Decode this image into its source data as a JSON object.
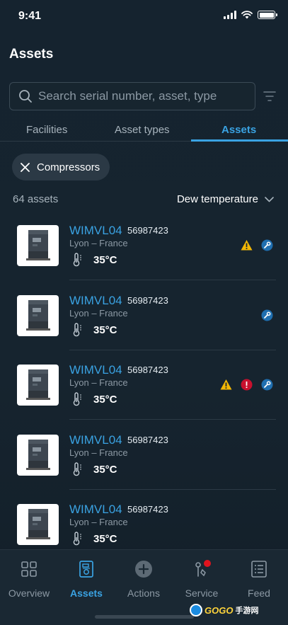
{
  "status_bar": {
    "time": "9:41"
  },
  "header": {
    "title": "Assets"
  },
  "search": {
    "placeholder": "Search serial number, asset, type"
  },
  "tabs": [
    {
      "label": "Facilities",
      "active": false
    },
    {
      "label": "Asset types",
      "active": false
    },
    {
      "label": "Assets",
      "active": true
    }
  ],
  "filter_chip": {
    "label": "Compressors"
  },
  "list_header": {
    "count": "64 assets",
    "sort_label": "Dew temperature"
  },
  "assets": [
    {
      "name": "WIMVL04",
      "serial": "56987423",
      "location": "Lyon – France",
      "temperature": "35°C",
      "badges": [
        "warning-icon",
        "wrench-icon"
      ]
    },
    {
      "name": "WIMVL04",
      "serial": "56987423",
      "location": "Lyon – France",
      "temperature": "35°C",
      "badges": [
        "wrench-icon"
      ]
    },
    {
      "name": "WIMVL04",
      "serial": "56987423",
      "location": "Lyon – France",
      "temperature": "35°C",
      "badges": [
        "warning-icon",
        "error-icon",
        "wrench-icon"
      ]
    },
    {
      "name": "WIMVL04",
      "serial": "56987423",
      "location": "Lyon – France",
      "temperature": "35°C",
      "badges": []
    },
    {
      "name": "WIMVL04",
      "serial": "56987423",
      "location": "Lyon – France",
      "temperature": "35°C",
      "badges": []
    }
  ],
  "bottom_nav": {
    "items": [
      {
        "label": "Overview",
        "icon": "grid-icon",
        "active": false
      },
      {
        "label": "Assets",
        "icon": "compressor-icon",
        "active": true
      },
      {
        "label": "Actions",
        "icon": "plus-circle-icon",
        "active": false
      },
      {
        "label": "Service",
        "icon": "service-icon",
        "active": false,
        "notification": true
      },
      {
        "label": "Feed",
        "icon": "feed-icon",
        "active": false
      }
    ]
  },
  "watermark": {
    "text": "GOGO",
    "suffix": "手游网"
  },
  "colors": {
    "accent": "#3aa3e3",
    "warning": "#f2b705",
    "error": "#c8102e",
    "background": "#16242f"
  }
}
